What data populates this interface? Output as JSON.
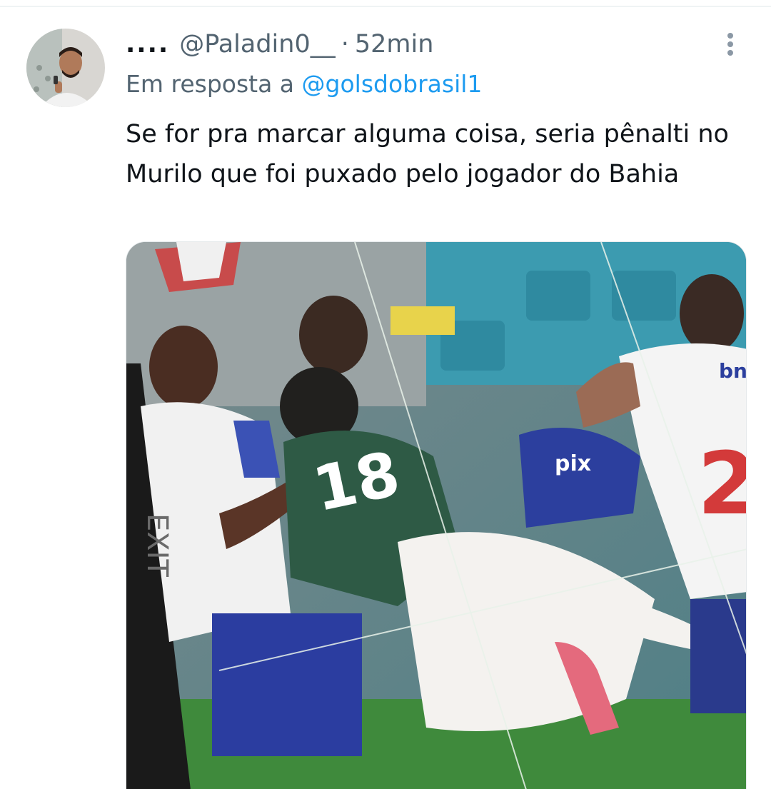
{
  "tweet": {
    "display_name": "....",
    "handle": "@Paladin0__",
    "separator": "·",
    "time": "52min",
    "reply_prefix": "Em resposta a",
    "reply_to": "@golsdobrasil1",
    "text": "Se for pra marcar alguma coisa, seria pênalti no Murilo que foi puxado pelo jogador do Bahia"
  },
  "media": {
    "jersey_number_green": "18",
    "jersey_number_white": "2",
    "sponsor_left": "bn",
    "sponsor_shorts": "pix",
    "sign_text": "EXIT"
  },
  "colors": {
    "text_primary": "#0f1419",
    "text_secondary": "#536471",
    "link": "#1d9bf0",
    "palmeiras_green": "#2e5a45",
    "bahia_blue": "#2c3f9e"
  },
  "icons": [
    "more-options-icon",
    "avatar"
  ]
}
